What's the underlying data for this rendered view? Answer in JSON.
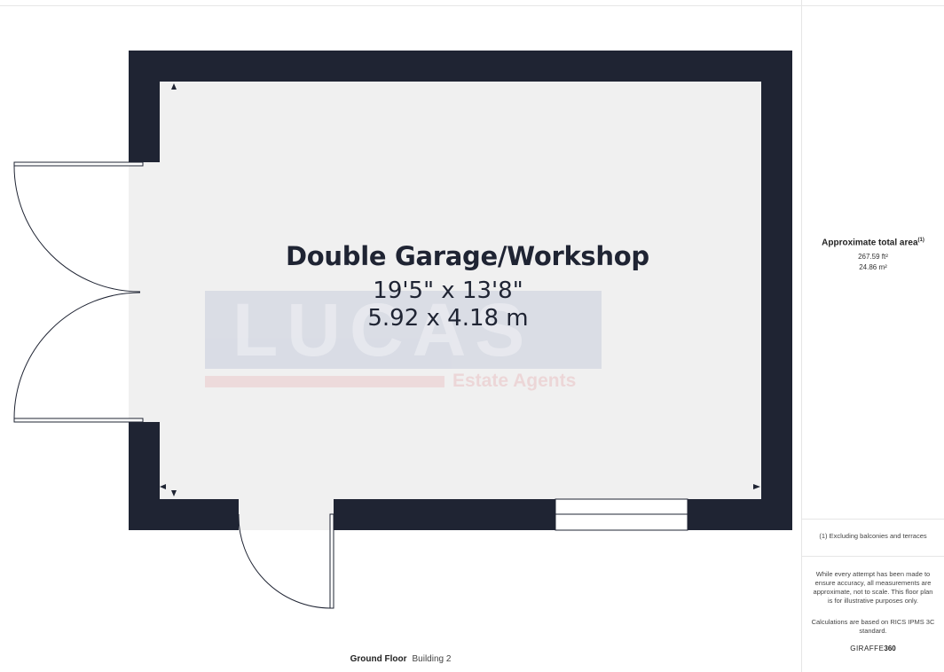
{
  "room": {
    "name": "Double Garage/Workshop",
    "dim_imperial": "19'5\" x 13'8\"",
    "dim_metric": "5.92 x 4.18 m"
  },
  "watermark": {
    "brand": "LUCAS",
    "sub": "Estate Agents"
  },
  "area": {
    "title": "Approximate total area",
    "note_marker": "(1)",
    "sqft": "267.59 ft²",
    "sqm": "24.86 m²"
  },
  "notes": {
    "excluding": "(1) Excluding balconies and terraces",
    "disclaimer": "While every attempt has been made to ensure accuracy, all measurements are approximate, not to scale. This floor plan is for illustrative purposes only.",
    "calculations": "Calculations are based on RICS IPMS 3C standard.",
    "brand_a": "GIRAFFE",
    "brand_b": "360"
  },
  "footer": {
    "floor": "Ground Floor",
    "building": "Building 2"
  },
  "colors": {
    "wall": "#1f2433",
    "floor": "#f0f0f0",
    "watermark_blue": "#1b3a8c",
    "watermark_red": "#d6202a"
  }
}
